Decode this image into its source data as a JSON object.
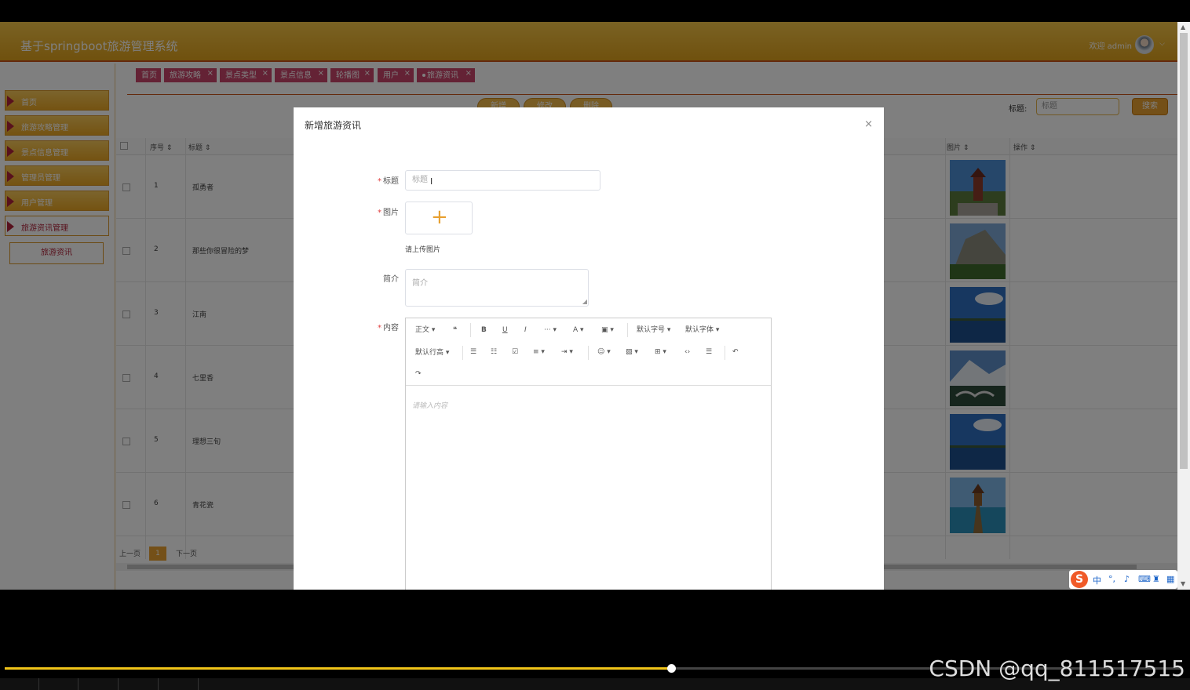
{
  "header": {
    "app_title": "基于springboot旅游管理系统",
    "welcome": "欢迎 admin"
  },
  "sidebar": {
    "items": [
      {
        "label": "首页"
      },
      {
        "label": "旅游攻略管理"
      },
      {
        "label": "景点信息管理"
      },
      {
        "label": "管理员管理"
      },
      {
        "label": "用户管理"
      },
      {
        "label": "旅游资讯管理"
      }
    ],
    "sub_item": "旅游资讯"
  },
  "tabs": [
    "首页",
    "旅游攻略",
    "景点类型",
    "景点信息",
    "轮播图",
    "用户",
    "旅游资讯"
  ],
  "toolbar": {
    "add": "新增",
    "edit": "修改",
    "delete": "删除",
    "search_label": "标题:",
    "search_placeholder": "标题",
    "search_button": "搜索"
  },
  "table": {
    "headers": {
      "index": "序号",
      "title": "标题",
      "image": "图片",
      "action": "操作"
    },
    "rows": [
      {
        "index": "1",
        "title": "孤勇者"
      },
      {
        "index": "2",
        "title": "那些你很冒险的梦"
      },
      {
        "index": "3",
        "title": "江南"
      },
      {
        "index": "4",
        "title": "七里香"
      },
      {
        "index": "5",
        "title": "理想三旬"
      },
      {
        "index": "6",
        "title": "青花瓷"
      }
    ]
  },
  "pager": {
    "prev": "上一页",
    "current": "1",
    "next": "下一页"
  },
  "dialog": {
    "title": "新增旅游资讯",
    "close": "×",
    "title_label": "标题",
    "title_placeholder": "标题",
    "image_label": "图片",
    "upload_tip": "请上传图片",
    "intro_label": "简介",
    "intro_placeholder": "简介",
    "content_label": "内容",
    "editor": {
      "tools": {
        "paragraph": "正文",
        "font_size": "默认字号",
        "font_family": "默认字体",
        "line_height": "默认行高"
      },
      "placeholder": "请输入内容"
    }
  },
  "ime": {
    "lang": "中"
  },
  "video": {
    "watermark": "CSDN @qq_811517515",
    "progress": 0.567
  },
  "colors": {
    "header": "#e9a624",
    "accent": "#c8456a",
    "button": "#f0b849",
    "brand_red": "#b1233a"
  }
}
